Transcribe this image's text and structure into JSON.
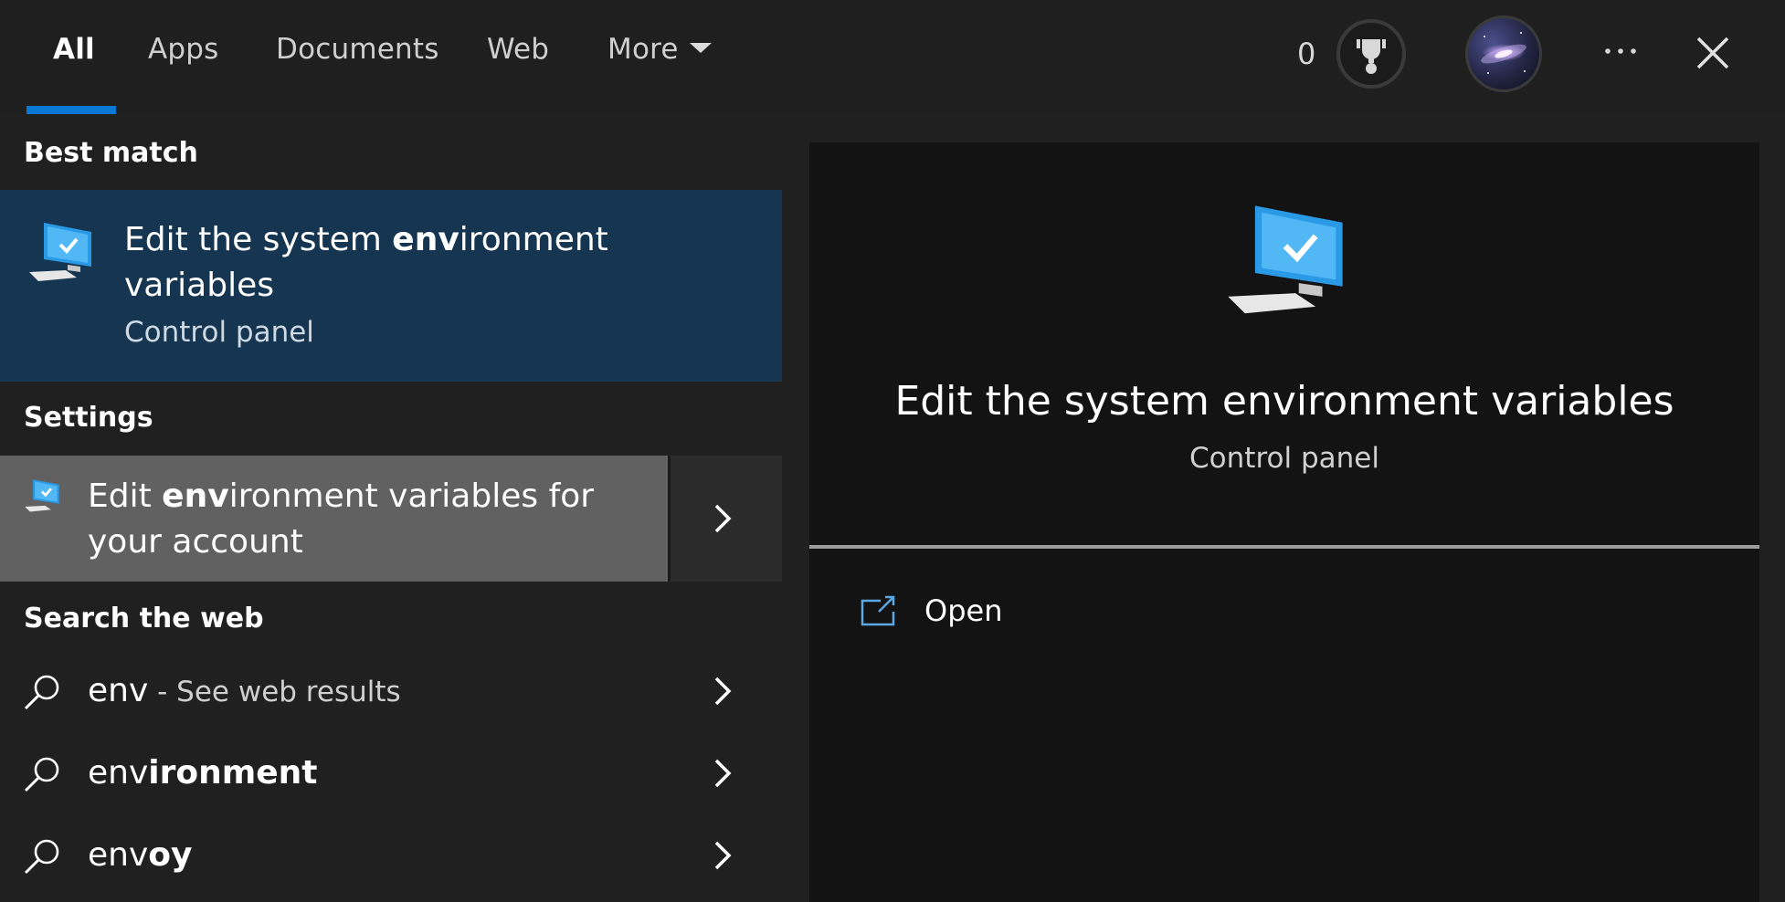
{
  "tabs": [
    {
      "label": "All",
      "active": true
    },
    {
      "label": "Apps"
    },
    {
      "label": "Documents"
    },
    {
      "label": "Web"
    },
    {
      "label": "More"
    }
  ],
  "header": {
    "points": "0",
    "trophy_icon": "trophy-icon",
    "avatar": "galaxy-avatar",
    "more_options_icon": "ellipsis-icon",
    "close_icon": "close-icon"
  },
  "best_match": {
    "heading": "Best match",
    "title_pre": "Edit the system ",
    "title_hl": "env",
    "title_post": "ironment variables",
    "subtitle": "Control panel",
    "icon": "monitor-check-icon"
  },
  "settings": {
    "heading": "Settings",
    "item_pre": "Edit ",
    "item_hl": "env",
    "item_post": "ironment variables for your account",
    "icon": "monitor-check-icon"
  },
  "web": {
    "heading": "Search the web",
    "results": [
      {
        "prefix": "env",
        "highlight": "",
        "suffix": " - See web results"
      },
      {
        "prefix": "env",
        "highlight": "ironment",
        "suffix": ""
      },
      {
        "prefix": "env",
        "highlight": "oy",
        "suffix": ""
      }
    ]
  },
  "preview": {
    "title": "Edit the system environment variables",
    "subtitle": "Control panel",
    "actions": [
      {
        "label": "Open",
        "icon": "open-external-icon"
      }
    ]
  },
  "colors": {
    "accent": "#0a78d7",
    "best_match_bg": "#153551",
    "settings_hover_bg": "#616161",
    "panel_bg": "#202020",
    "preview_bg": "#131313"
  }
}
